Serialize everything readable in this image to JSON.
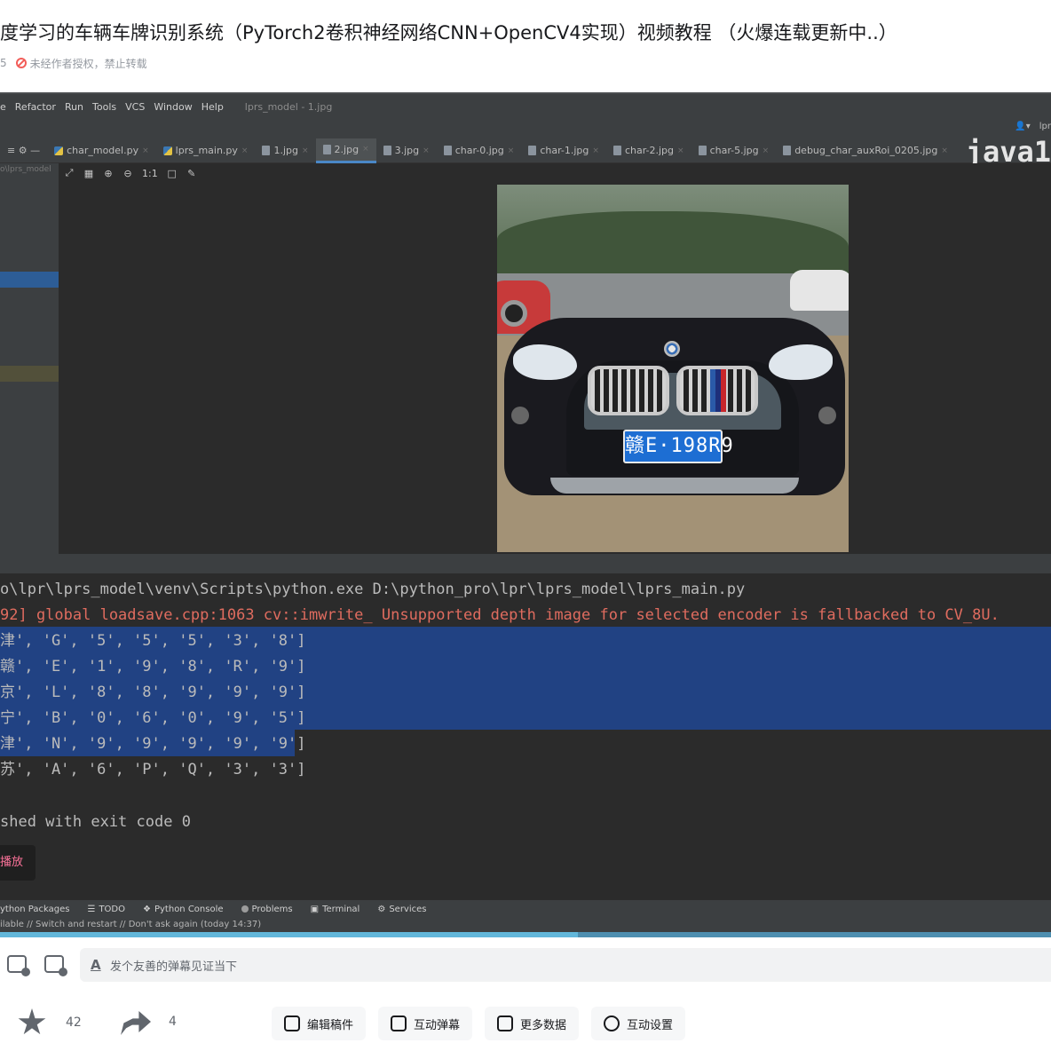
{
  "header": {
    "title": "度学习的车辆车牌识别系统（PyTorch2卷积神经网络CNN+OpenCV4实现）视频教程 （火爆连载更新中..）",
    "meta_prefix": "5",
    "copyright_notice": "未经作者授权，禁止转载"
  },
  "ide": {
    "menu": [
      "e",
      "Refactor",
      "Run",
      "Tools",
      "VCS",
      "Window",
      "Help"
    ],
    "project_title": "lprs_model - 1.jpg",
    "toolbar_right": [
      "lpr"
    ],
    "watermark": "java1",
    "tabs": [
      {
        "label": "char_model.py",
        "icon": "python-file-icon",
        "active": false
      },
      {
        "label": "lprs_main.py",
        "icon": "python-file-icon",
        "active": false
      },
      {
        "label": "1.jpg",
        "icon": "image-file-icon",
        "active": false
      },
      {
        "label": "2.jpg",
        "icon": "image-file-icon",
        "active": true
      },
      {
        "label": "3.jpg",
        "icon": "image-file-icon",
        "active": false
      },
      {
        "label": "char-0.jpg",
        "icon": "image-file-icon",
        "active": false
      },
      {
        "label": "char-1.jpg",
        "icon": "image-file-icon",
        "active": false
      },
      {
        "label": "char-2.jpg",
        "icon": "image-file-icon",
        "active": false
      },
      {
        "label": "char-5.jpg",
        "icon": "image-file-icon",
        "active": false
      },
      {
        "label": "debug_char_auxRoi_0205.jpg",
        "icon": "image-file-icon",
        "active": false
      }
    ],
    "project_path": "o\\lprs_model",
    "image_toolbar": [
      "fit-icon",
      "grid-icon",
      "zoom-in-icon",
      "zoom-out-icon",
      "1:1",
      "background-icon",
      "eyedropper-icon"
    ],
    "plate_text": "赣E·198R9",
    "console": {
      "command": "o\\lpr\\lprs_model\\venv\\Scripts\\python.exe D:\\python_pro\\lpr\\lprs_model\\lprs_main.py",
      "warning": "92] global loadsave.cpp:1063 cv::imwrite_ Unsupported depth image for selected encoder is fallbacked to CV_8U.",
      "results": [
        "津', 'G', '5', '5', '5', '3', '8']",
        "赣', 'E', '1', '9', '8', 'R', '9']",
        "京', 'L', '8', '8', '9', '9', '9']",
        "宁', 'B', '0', '6', '0', '9', '5']",
        "津', 'N', '9', '9', '9', '9', '9']",
        "苏', 'A', '6', 'P', 'Q', '3', '3']"
      ],
      "exit_line": "shed with exit code 0",
      "play_button": "播放"
    },
    "bottom_tools": [
      "ython Packages",
      "TODO",
      "Python Console",
      "Problems",
      "Terminal",
      "Services"
    ],
    "status_text": "ilable // Switch and restart // Don't ask again (today 14:37)",
    "progress_fraction": 0.55
  },
  "danmaku": {
    "placeholder": "发个友善的弹幕见证当下"
  },
  "actions": {
    "favorites_count": "42",
    "share_count": "4",
    "buttons": [
      "编辑稿件",
      "互动弹幕",
      "更多数据",
      "互动设置"
    ]
  },
  "colors": {
    "accent_pink": "#fb7299",
    "ide_selection": "#214283",
    "console_error": "#e06c5f"
  }
}
